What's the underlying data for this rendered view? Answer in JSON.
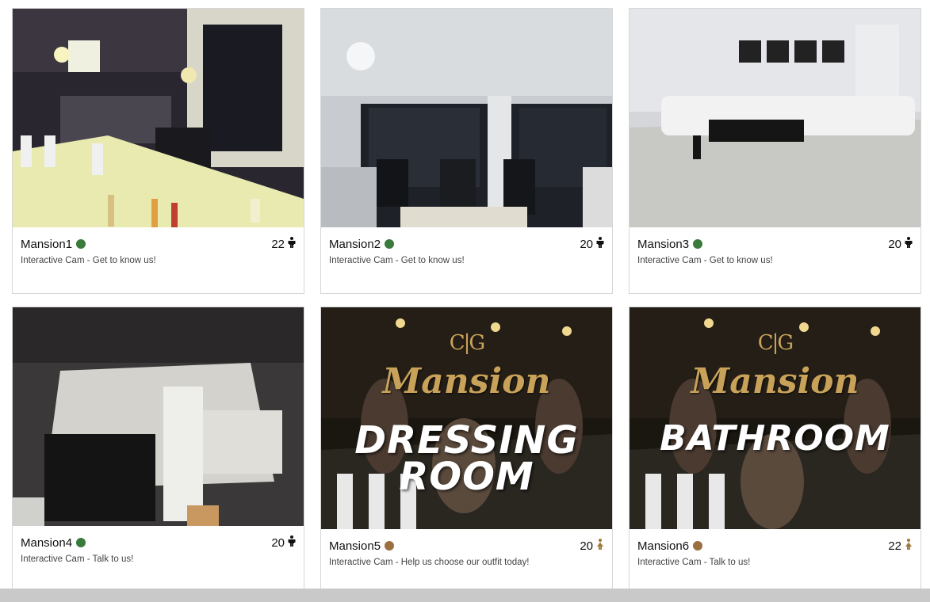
{
  "cams": [
    {
      "name": "Mansion1",
      "status": "online",
      "status_color": "#3a7a3c",
      "viewers": "22",
      "viewer_icon": "male-person-icon",
      "description": "Interactive Cam - Get to know us!"
    },
    {
      "name": "Mansion2",
      "status": "online",
      "status_color": "#3a7a3c",
      "viewers": "20",
      "viewer_icon": "male-person-icon",
      "description": "Interactive Cam - Get to know us!"
    },
    {
      "name": "Mansion3",
      "status": "online",
      "status_color": "#3a7a3c",
      "viewers": "20",
      "viewer_icon": "male-person-icon",
      "description": "Interactive Cam - Get to know us!"
    },
    {
      "name": "Mansion4",
      "status": "online",
      "status_color": "#3a7a3c",
      "viewers": "20",
      "viewer_icon": "male-person-icon",
      "description": "Interactive Cam - Talk to us!"
    },
    {
      "name": "Mansion5",
      "status": "premium",
      "status_color": "#9a7040",
      "viewers": "20",
      "viewer_icon": "female-person-icon",
      "description": "Interactive Cam - Help us choose our outfit today!",
      "thumb_brand": "Mansion",
      "thumb_title_line1": "DRESSING",
      "thumb_title_line2": "ROOM"
    },
    {
      "name": "Mansion6",
      "status": "premium",
      "status_color": "#9a7040",
      "viewers": "22",
      "viewer_icon": "female-person-icon",
      "description": "Interactive Cam - Talk to us!",
      "thumb_brand": "Mansion",
      "thumb_title_line1": "BATHROOM"
    }
  ]
}
